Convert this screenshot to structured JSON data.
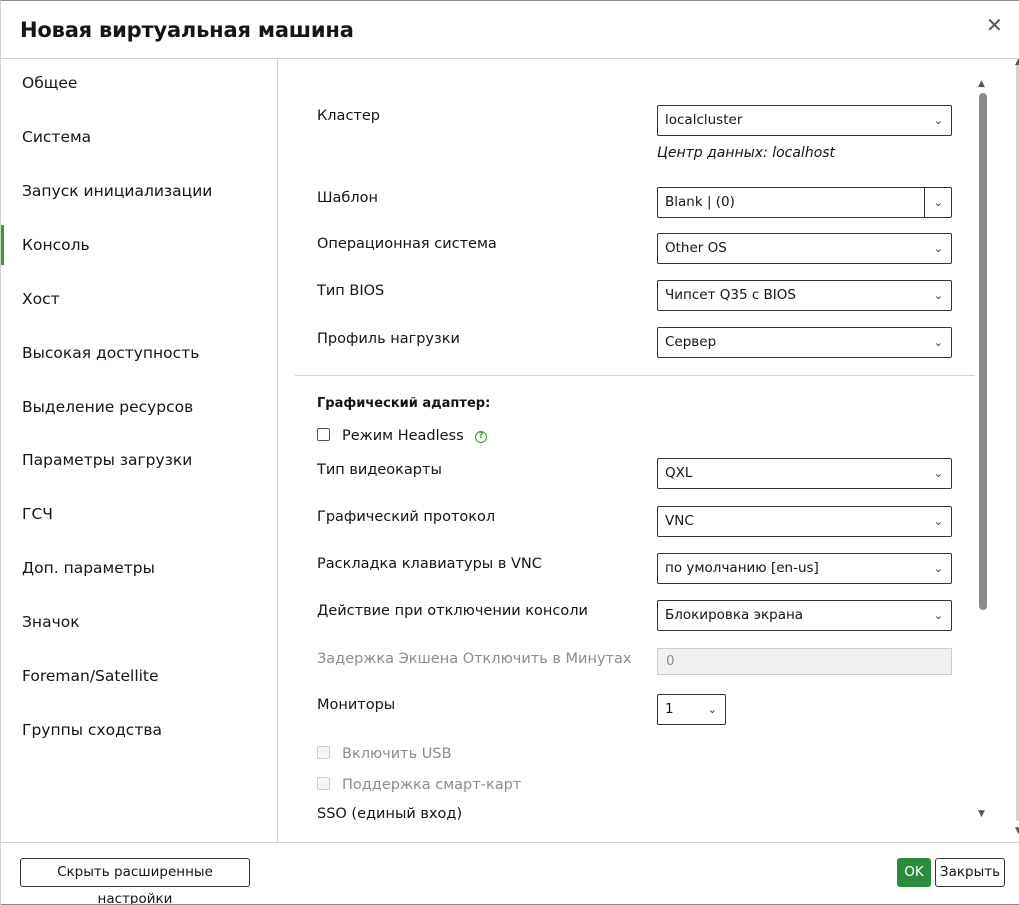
{
  "dialog": {
    "title": "Новая виртуальная машина",
    "close_icon": "close-icon"
  },
  "sidebar": {
    "active_color": "#3f9c35",
    "items": [
      {
        "label": "Общее"
      },
      {
        "label": "Система"
      },
      {
        "label": "Запуск инициализации"
      },
      {
        "label": "Консоль"
      },
      {
        "label": "Хост"
      },
      {
        "label": "Высокая доступность"
      },
      {
        "label": "Выделение ресурсов"
      },
      {
        "label": "Параметры загрузки"
      },
      {
        "label": "ГСЧ"
      },
      {
        "label": "Доп. параметры"
      },
      {
        "label": "Значок"
      },
      {
        "label": "Foreman/Satellite"
      },
      {
        "label": "Группы сходства"
      }
    ]
  },
  "form": {
    "cluster": {
      "label": "Кластер",
      "value": "localcluster",
      "note": "Центр данных: localhost"
    },
    "template": {
      "label": "Шаблон",
      "value": "Blank |  (0)"
    },
    "os": {
      "label": "Операционная система",
      "value": "Other OS"
    },
    "bios": {
      "label": "Тип BIOS",
      "value": "Чипсет Q35 с BIOS"
    },
    "profile": {
      "label": "Профиль нагрузки",
      "value": "Сервер"
    },
    "graphics_section": "Графический адаптер:",
    "headless": {
      "label": "Режим Headless",
      "checked": false,
      "help_glyph": "?"
    },
    "video": {
      "label": "Тип видеокарты",
      "value": "QXL"
    },
    "protocol": {
      "label": "Графический протокол",
      "value": "VNC"
    },
    "keyboard": {
      "label": "Раскладка клавиатуры в VNC",
      "value": "по умолчанию [en-us]"
    },
    "disconnect": {
      "label": "Действие при отключении консоли",
      "value": "Блокировка экрана"
    },
    "delay": {
      "label": "Задержка Экшена Отключить в Минутах",
      "value": "0"
    },
    "monitors": {
      "label": "Мониторы",
      "value": "1"
    },
    "usb": {
      "label": "Включить USB",
      "checked": false
    },
    "smartcard": {
      "label": "Поддержка смарт-карт",
      "checked": false
    },
    "sso": {
      "label": "SSO (единый вход)"
    }
  },
  "footer": {
    "advanced_label": "Скрыть расширенные настройки",
    "ok_label": "OK",
    "close_label": "Закрыть",
    "ok_color": "#2d8a3e"
  }
}
